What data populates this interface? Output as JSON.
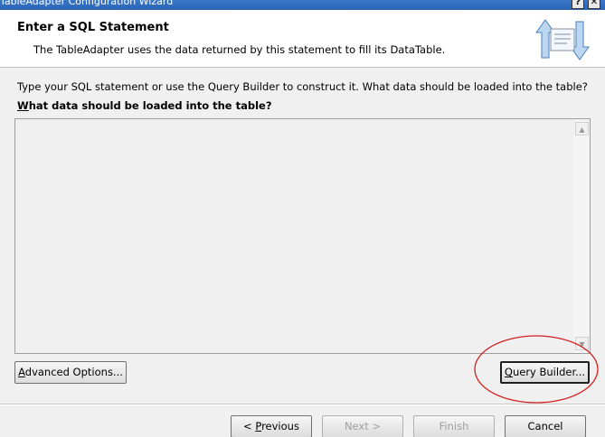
{
  "window": {
    "title": "TableAdapter Configuration Wizard",
    "help_glyph": "?",
    "close_glyph": "✕"
  },
  "header": {
    "title": "Enter a SQL Statement",
    "description": "The TableAdapter uses the data returned by this statement to fill its DataTable."
  },
  "main": {
    "instruction": "Type your SQL statement or use the Query Builder to construct it. What data should be loaded into the table?",
    "query_label": "What data should be loaded into the table?",
    "query_label_access_key": "W",
    "query_label_rest": "hat data should be loaded into the table?",
    "sql_text": ""
  },
  "buttons": {
    "advanced_key": "A",
    "advanced_rest": "dvanced Options...",
    "query_key": "Q",
    "query_rest": "uery Builder...",
    "previous_prefix": "< ",
    "previous_key": "P",
    "previous_rest": "revious",
    "next": "Next >",
    "finish": "Finish",
    "cancel": "Cancel"
  },
  "icons": {
    "wizard_icon": "wizard-arrows-icon",
    "scroll_up": "▲",
    "scroll_down": "▼"
  },
  "colors": {
    "titlebar": "#2f6bbd",
    "highlight": "#d42020",
    "dialog_bg": "#f0f0f0"
  }
}
